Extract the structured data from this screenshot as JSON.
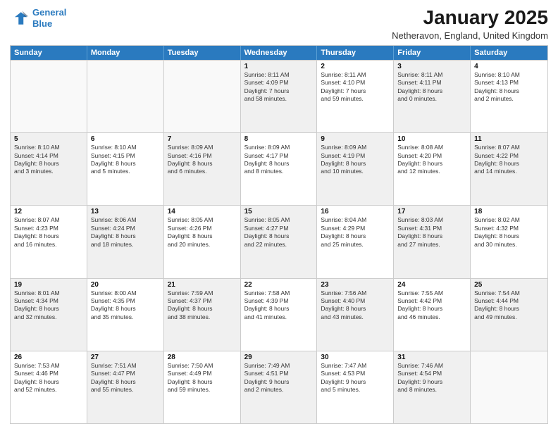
{
  "header": {
    "logo_line1": "General",
    "logo_line2": "Blue",
    "month_title": "January 2025",
    "location": "Netheravon, England, United Kingdom"
  },
  "weekdays": [
    "Sunday",
    "Monday",
    "Tuesday",
    "Wednesday",
    "Thursday",
    "Friday",
    "Saturday"
  ],
  "rows": [
    [
      {
        "day": "",
        "info": "",
        "empty": true
      },
      {
        "day": "",
        "info": "",
        "empty": true
      },
      {
        "day": "",
        "info": "",
        "empty": true
      },
      {
        "day": "1",
        "info": "Sunrise: 8:11 AM\nSunset: 4:09 PM\nDaylight: 7 hours\nand 58 minutes.",
        "shaded": true
      },
      {
        "day": "2",
        "info": "Sunrise: 8:11 AM\nSunset: 4:10 PM\nDaylight: 7 hours\nand 59 minutes.",
        "shaded": false
      },
      {
        "day": "3",
        "info": "Sunrise: 8:11 AM\nSunset: 4:11 PM\nDaylight: 8 hours\nand 0 minutes.",
        "shaded": true
      },
      {
        "day": "4",
        "info": "Sunrise: 8:10 AM\nSunset: 4:13 PM\nDaylight: 8 hours\nand 2 minutes.",
        "shaded": false
      }
    ],
    [
      {
        "day": "5",
        "info": "Sunrise: 8:10 AM\nSunset: 4:14 PM\nDaylight: 8 hours\nand 3 minutes.",
        "shaded": true
      },
      {
        "day": "6",
        "info": "Sunrise: 8:10 AM\nSunset: 4:15 PM\nDaylight: 8 hours\nand 5 minutes.",
        "shaded": false
      },
      {
        "day": "7",
        "info": "Sunrise: 8:09 AM\nSunset: 4:16 PM\nDaylight: 8 hours\nand 6 minutes.",
        "shaded": true
      },
      {
        "day": "8",
        "info": "Sunrise: 8:09 AM\nSunset: 4:17 PM\nDaylight: 8 hours\nand 8 minutes.",
        "shaded": false
      },
      {
        "day": "9",
        "info": "Sunrise: 8:09 AM\nSunset: 4:19 PM\nDaylight: 8 hours\nand 10 minutes.",
        "shaded": true
      },
      {
        "day": "10",
        "info": "Sunrise: 8:08 AM\nSunset: 4:20 PM\nDaylight: 8 hours\nand 12 minutes.",
        "shaded": false
      },
      {
        "day": "11",
        "info": "Sunrise: 8:07 AM\nSunset: 4:22 PM\nDaylight: 8 hours\nand 14 minutes.",
        "shaded": true
      }
    ],
    [
      {
        "day": "12",
        "info": "Sunrise: 8:07 AM\nSunset: 4:23 PM\nDaylight: 8 hours\nand 16 minutes.",
        "shaded": false
      },
      {
        "day": "13",
        "info": "Sunrise: 8:06 AM\nSunset: 4:24 PM\nDaylight: 8 hours\nand 18 minutes.",
        "shaded": true
      },
      {
        "day": "14",
        "info": "Sunrise: 8:05 AM\nSunset: 4:26 PM\nDaylight: 8 hours\nand 20 minutes.",
        "shaded": false
      },
      {
        "day": "15",
        "info": "Sunrise: 8:05 AM\nSunset: 4:27 PM\nDaylight: 8 hours\nand 22 minutes.",
        "shaded": true
      },
      {
        "day": "16",
        "info": "Sunrise: 8:04 AM\nSunset: 4:29 PM\nDaylight: 8 hours\nand 25 minutes.",
        "shaded": false
      },
      {
        "day": "17",
        "info": "Sunrise: 8:03 AM\nSunset: 4:31 PM\nDaylight: 8 hours\nand 27 minutes.",
        "shaded": true
      },
      {
        "day": "18",
        "info": "Sunrise: 8:02 AM\nSunset: 4:32 PM\nDaylight: 8 hours\nand 30 minutes.",
        "shaded": false
      }
    ],
    [
      {
        "day": "19",
        "info": "Sunrise: 8:01 AM\nSunset: 4:34 PM\nDaylight: 8 hours\nand 32 minutes.",
        "shaded": true
      },
      {
        "day": "20",
        "info": "Sunrise: 8:00 AM\nSunset: 4:35 PM\nDaylight: 8 hours\nand 35 minutes.",
        "shaded": false
      },
      {
        "day": "21",
        "info": "Sunrise: 7:59 AM\nSunset: 4:37 PM\nDaylight: 8 hours\nand 38 minutes.",
        "shaded": true
      },
      {
        "day": "22",
        "info": "Sunrise: 7:58 AM\nSunset: 4:39 PM\nDaylight: 8 hours\nand 41 minutes.",
        "shaded": false
      },
      {
        "day": "23",
        "info": "Sunrise: 7:56 AM\nSunset: 4:40 PM\nDaylight: 8 hours\nand 43 minutes.",
        "shaded": true
      },
      {
        "day": "24",
        "info": "Sunrise: 7:55 AM\nSunset: 4:42 PM\nDaylight: 8 hours\nand 46 minutes.",
        "shaded": false
      },
      {
        "day": "25",
        "info": "Sunrise: 7:54 AM\nSunset: 4:44 PM\nDaylight: 8 hours\nand 49 minutes.",
        "shaded": true
      }
    ],
    [
      {
        "day": "26",
        "info": "Sunrise: 7:53 AM\nSunset: 4:46 PM\nDaylight: 8 hours\nand 52 minutes.",
        "shaded": false
      },
      {
        "day": "27",
        "info": "Sunrise: 7:51 AM\nSunset: 4:47 PM\nDaylight: 8 hours\nand 55 minutes.",
        "shaded": true
      },
      {
        "day": "28",
        "info": "Sunrise: 7:50 AM\nSunset: 4:49 PM\nDaylight: 8 hours\nand 59 minutes.",
        "shaded": false
      },
      {
        "day": "29",
        "info": "Sunrise: 7:49 AM\nSunset: 4:51 PM\nDaylight: 9 hours\nand 2 minutes.",
        "shaded": true
      },
      {
        "day": "30",
        "info": "Sunrise: 7:47 AM\nSunset: 4:53 PM\nDaylight: 9 hours\nand 5 minutes.",
        "shaded": false
      },
      {
        "day": "31",
        "info": "Sunrise: 7:46 AM\nSunset: 4:54 PM\nDaylight: 9 hours\nand 8 minutes.",
        "shaded": true
      },
      {
        "day": "",
        "info": "",
        "empty": true
      }
    ]
  ]
}
